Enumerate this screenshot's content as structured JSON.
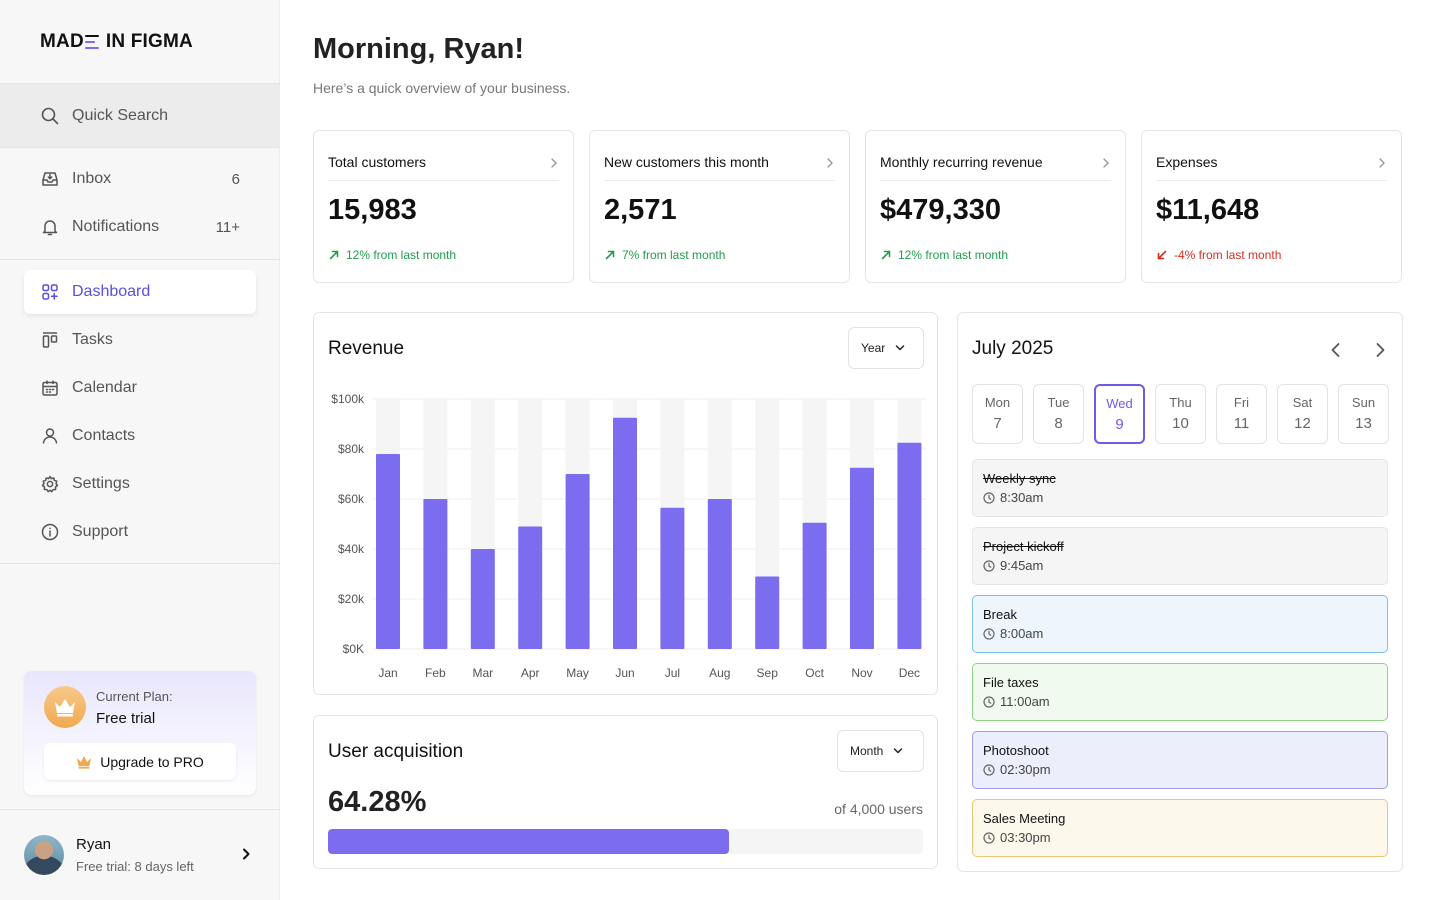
{
  "brand": {
    "logo_left": "MAD",
    "logo_right": "IN FIGMA"
  },
  "sidebar": {
    "search": {
      "label": "Quick Search",
      "icon": "search-icon"
    },
    "top_items": [
      {
        "label": "Inbox",
        "count": "6",
        "icon": "inbox-icon"
      },
      {
        "label": "Notifications",
        "count": "11+",
        "icon": "bell-icon"
      }
    ],
    "items": [
      {
        "label": "Dashboard",
        "icon": "dashboard-icon",
        "active": true
      },
      {
        "label": "Tasks",
        "icon": "tasks-icon"
      },
      {
        "label": "Calendar",
        "icon": "calendar-icon"
      },
      {
        "label": "Contacts",
        "icon": "user-icon"
      },
      {
        "label": "Settings",
        "icon": "gear-icon"
      },
      {
        "label": "Support",
        "icon": "info-icon"
      }
    ],
    "plan": {
      "label": "Current Plan:",
      "value": "Free trial",
      "upgrade_label": "Upgrade to PRO"
    },
    "user": {
      "name": "Ryan",
      "subtitle": "Free trial: 8 days left"
    }
  },
  "header": {
    "greeting_prefix": "Morning, ",
    "greeting_name": "Ryan!",
    "subtitle": "Here’s a quick overview of your business."
  },
  "stats": [
    {
      "label": "Total customers",
      "value": "15,983",
      "delta": "12% from last month",
      "trend": "up"
    },
    {
      "label": "New customers this month",
      "value": "2,571",
      "delta": "7% from last month",
      "trend": "up"
    },
    {
      "label": "Monthly recurring revenue",
      "value": "$479,330",
      "delta": "12% from last month",
      "trend": "up"
    },
    {
      "label": "Expenses",
      "value": "$11,648",
      "delta": "-4% from last month",
      "trend": "down"
    }
  ],
  "colors": {
    "accent": "#7c6cf0",
    "up": "#1f9d4c",
    "down": "#d92d20"
  },
  "revenue": {
    "title": "Revenue",
    "period": "Year"
  },
  "chart_data": {
    "type": "bar",
    "title": "Revenue",
    "categories": [
      "Jan",
      "Feb",
      "Mar",
      "Apr",
      "May",
      "Jun",
      "Jul",
      "Aug",
      "Sep",
      "Oct",
      "Nov",
      "Dec"
    ],
    "values": [
      78000,
      60000,
      40000,
      49000,
      70000,
      92500,
      56500,
      60000,
      29000,
      50500,
      72500,
      82500
    ],
    "ylim": [
      0,
      100000
    ],
    "yticks": [
      "$0K",
      "$20k",
      "$40k",
      "$60k",
      "$80k",
      "$100k"
    ],
    "ytick_values": [
      0,
      20000,
      40000,
      60000,
      80000,
      100000
    ],
    "grid": true,
    "color": "#7c6cf0"
  },
  "acquisition": {
    "title": "User acquisition",
    "period": "Month",
    "value": "64.28%",
    "of_label": "of 4,000 users",
    "progress": 0.6745
  },
  "calendar": {
    "month": "July 2025",
    "days": [
      {
        "name": "Mon",
        "date": "7"
      },
      {
        "name": "Tue",
        "date": "8"
      },
      {
        "name": "Wed",
        "date": "9",
        "selected": true
      },
      {
        "name": "Thu",
        "date": "10"
      },
      {
        "name": "Fri",
        "date": "11"
      },
      {
        "name": "Sat",
        "date": "12"
      },
      {
        "name": "Sun",
        "date": "13"
      }
    ],
    "events": [
      {
        "title": "Weekly sync",
        "time": "8:30am",
        "done": true,
        "bg": "#f5f5f5",
        "border": "#e6e6e6"
      },
      {
        "title": "Project kickoff",
        "time": "9:45am",
        "done": true,
        "bg": "#f5f5f5",
        "border": "#e6e6e6"
      },
      {
        "title": "Break",
        "time": "8:00am",
        "done": false,
        "bg": "#eef6fd",
        "border": "#7fc0ea"
      },
      {
        "title": "File taxes",
        "time": "11:00am",
        "done": false,
        "bg": "#f1faef",
        "border": "#8fd486"
      },
      {
        "title": "Photoshoot",
        "time": "02:30pm",
        "done": false,
        "bg": "#edeefb",
        "border": "#9aa0e6"
      },
      {
        "title": "Sales Meeting",
        "time": "03:30pm",
        "done": false,
        "bg": "#fdf8ec",
        "border": "#ebc677"
      }
    ]
  }
}
